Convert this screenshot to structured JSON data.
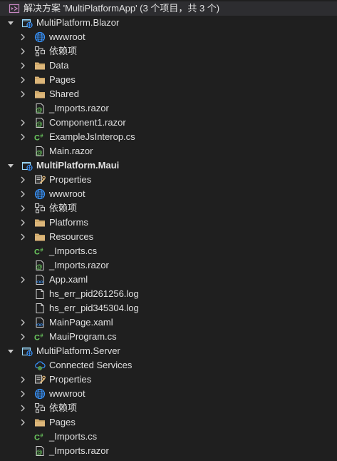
{
  "solution": {
    "label": "解决方案 'MultiPlatformApp' (3 个项目，共 3 个)"
  },
  "rows": [
    {
      "label": "MultiPlatform.Blazor",
      "icon": "project-icon",
      "level": 0,
      "chevron": "down",
      "bold": false
    },
    {
      "label": "wwwroot",
      "icon": "globe-icon",
      "level": 1,
      "chevron": "right"
    },
    {
      "label": "依赖项",
      "icon": "dependencies-icon",
      "level": 1,
      "chevron": "right"
    },
    {
      "label": "Data",
      "icon": "folder-icon",
      "level": 1,
      "chevron": "right"
    },
    {
      "label": "Pages",
      "icon": "folder-icon",
      "level": 1,
      "chevron": "right"
    },
    {
      "label": "Shared",
      "icon": "folder-icon",
      "level": 1,
      "chevron": "right"
    },
    {
      "label": "_Imports.razor",
      "icon": "razor-icon",
      "level": 1,
      "chevron": "none"
    },
    {
      "label": "Component1.razor",
      "icon": "razor-icon",
      "level": 1,
      "chevron": "right"
    },
    {
      "label": "ExampleJsInterop.cs",
      "icon": "csharp-icon",
      "level": 1,
      "chevron": "right"
    },
    {
      "label": "Main.razor",
      "icon": "razor-icon",
      "level": 1,
      "chevron": "none"
    },
    {
      "label": "MultiPlatform.Maui",
      "icon": "project-icon",
      "level": 0,
      "chevron": "down",
      "bold": true
    },
    {
      "label": "Properties",
      "icon": "wrench-icon",
      "level": 1,
      "chevron": "right"
    },
    {
      "label": "wwwroot",
      "icon": "globe-icon",
      "level": 1,
      "chevron": "right"
    },
    {
      "label": "依赖项",
      "icon": "dependencies-icon",
      "level": 1,
      "chevron": "right"
    },
    {
      "label": "Platforms",
      "icon": "folder-icon",
      "level": 1,
      "chevron": "right"
    },
    {
      "label": "Resources",
      "icon": "folder-icon",
      "level": 1,
      "chevron": "right"
    },
    {
      "label": "_Imports.cs",
      "icon": "csharp-icon",
      "level": 1,
      "chevron": "none"
    },
    {
      "label": "_Imports.razor",
      "icon": "razor-icon",
      "level": 1,
      "chevron": "none"
    },
    {
      "label": "App.xaml",
      "icon": "xaml-icon",
      "level": 1,
      "chevron": "right"
    },
    {
      "label": "hs_err_pid261256.log",
      "icon": "file-icon",
      "level": 1,
      "chevron": "none"
    },
    {
      "label": "hs_err_pid345304.log",
      "icon": "file-icon",
      "level": 1,
      "chevron": "none"
    },
    {
      "label": "MainPage.xaml",
      "icon": "xaml-icon",
      "level": 1,
      "chevron": "right"
    },
    {
      "label": "MauiProgram.cs",
      "icon": "csharp-icon",
      "level": 1,
      "chevron": "right"
    },
    {
      "label": "MultiPlatform.Server",
      "icon": "project-icon",
      "level": 0,
      "chevron": "down",
      "bold": false
    },
    {
      "label": "Connected Services",
      "icon": "connected-services-icon",
      "level": 1,
      "chevron": "none"
    },
    {
      "label": "Properties",
      "icon": "wrench-icon",
      "level": 1,
      "chevron": "right"
    },
    {
      "label": "wwwroot",
      "icon": "globe-icon",
      "level": 1,
      "chevron": "right"
    },
    {
      "label": "依赖项",
      "icon": "dependencies-icon",
      "level": 1,
      "chevron": "right"
    },
    {
      "label": "Pages",
      "icon": "folder-icon",
      "level": 1,
      "chevron": "right"
    },
    {
      "label": "_Imports.cs",
      "icon": "csharp-icon",
      "level": 1,
      "chevron": "none"
    },
    {
      "label": "_Imports.razor",
      "icon": "razor-icon",
      "level": 1,
      "chevron": "none"
    }
  ],
  "colors": {
    "background": "#1f1f1f",
    "text": "#e0e0e0",
    "folder": "#dcb67a",
    "globe": "#3794ff",
    "csharp": "#6ccb5f",
    "razor": "#6ccb5f",
    "solution": "#c586c0"
  }
}
